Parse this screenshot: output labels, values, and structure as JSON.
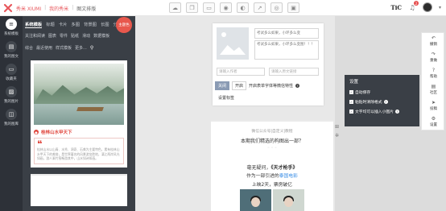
{
  "topbar": {
    "brand": {
      "part1": "秀米 XIUMI",
      "part2": "我的秀米",
      "part3": "图文排版"
    },
    "tool_icons": [
      "cloud-save-icon",
      "copy-icon",
      "folder-icon",
      "preview-icon",
      "palette-icon",
      "share-icon",
      "camera-icon",
      "image-icon"
    ],
    "right": {
      "tic_logo": "TiC",
      "notification_count": "2"
    }
  },
  "leftnav": {
    "items": [
      {
        "label": "系统模板",
        "icon": "menu-icon"
      },
      {
        "label": "我的图文",
        "icon": "template-icon"
      },
      {
        "label": "收藏夹",
        "icon": "folder-icon"
      },
      {
        "label": "我的图片",
        "icon": "image-icon"
      },
      {
        "label": "我的图库",
        "icon": "gallery-icon"
      }
    ]
  },
  "template_panel": {
    "tabs_row1": [
      "系统模板",
      "标题",
      "卡片",
      "多图",
      "背景图",
      "长图",
      "分割线"
    ],
    "tabs_row2": [
      "关注和阅读",
      "图表",
      "零件",
      "贴纸",
      "滑动",
      "数据模板"
    ],
    "tabs_row3": [
      "综合",
      "最近使用",
      "样式模板",
      "更多..."
    ],
    "theme_button": "主题色",
    "card": {
      "title": "桂林山水甲天下",
      "quote_text": "桂林山水以山青、水秀、洞奇、石美为主要特色，素有桂林山水甲天下的美誉，是世界著名的风景游览胜地，漓江两岸风光如画，游人乘竹筏畅游其中，山水如诗如画。"
    }
  },
  "editor": {
    "text1": "考试多么如果，小环多么变",
    "text2": "考试多么如果，小环多么变图！！！",
    "author_placeholder": "请输入作者",
    "source_placeholder": "请输入原文链接",
    "toggle_off": "关闭",
    "toggle_on": "开启",
    "open_label": "开启表单字体等微信特性",
    "settings_label": "设置标签"
  },
  "article": {
    "line1": "微信公众号|自定义|教程",
    "line2": "本期我们精选的构图出一部？",
    "dots": "◦ ◦ ◦",
    "line3_pre": "毫无疑问，",
    "line3_bold": "《天才枪手》",
    "line4_pre": "作为一部引进的",
    "line4_hl": "泰国电影",
    "line5": "上映2天，票房破亿"
  },
  "settings": {
    "title": "设置",
    "options": [
      {
        "label": "自动保存",
        "checked": true
      },
      {
        "label": "粘贴时清除格式",
        "checked": true
      },
      {
        "label": "文字均可以插入小图片",
        "checked": true
      }
    ]
  },
  "rightbar": {
    "items": [
      {
        "label": "撤销",
        "icon": "undo-icon"
      },
      {
        "label": "重做",
        "icon": "redo-icon"
      },
      {
        "label": "帮助",
        "icon": "help-icon"
      },
      {
        "label": "社区",
        "icon": "community-icon"
      },
      {
        "label": "投稿",
        "icon": "submit-icon"
      },
      {
        "label": "设置",
        "icon": "gear-icon"
      }
    ]
  }
}
